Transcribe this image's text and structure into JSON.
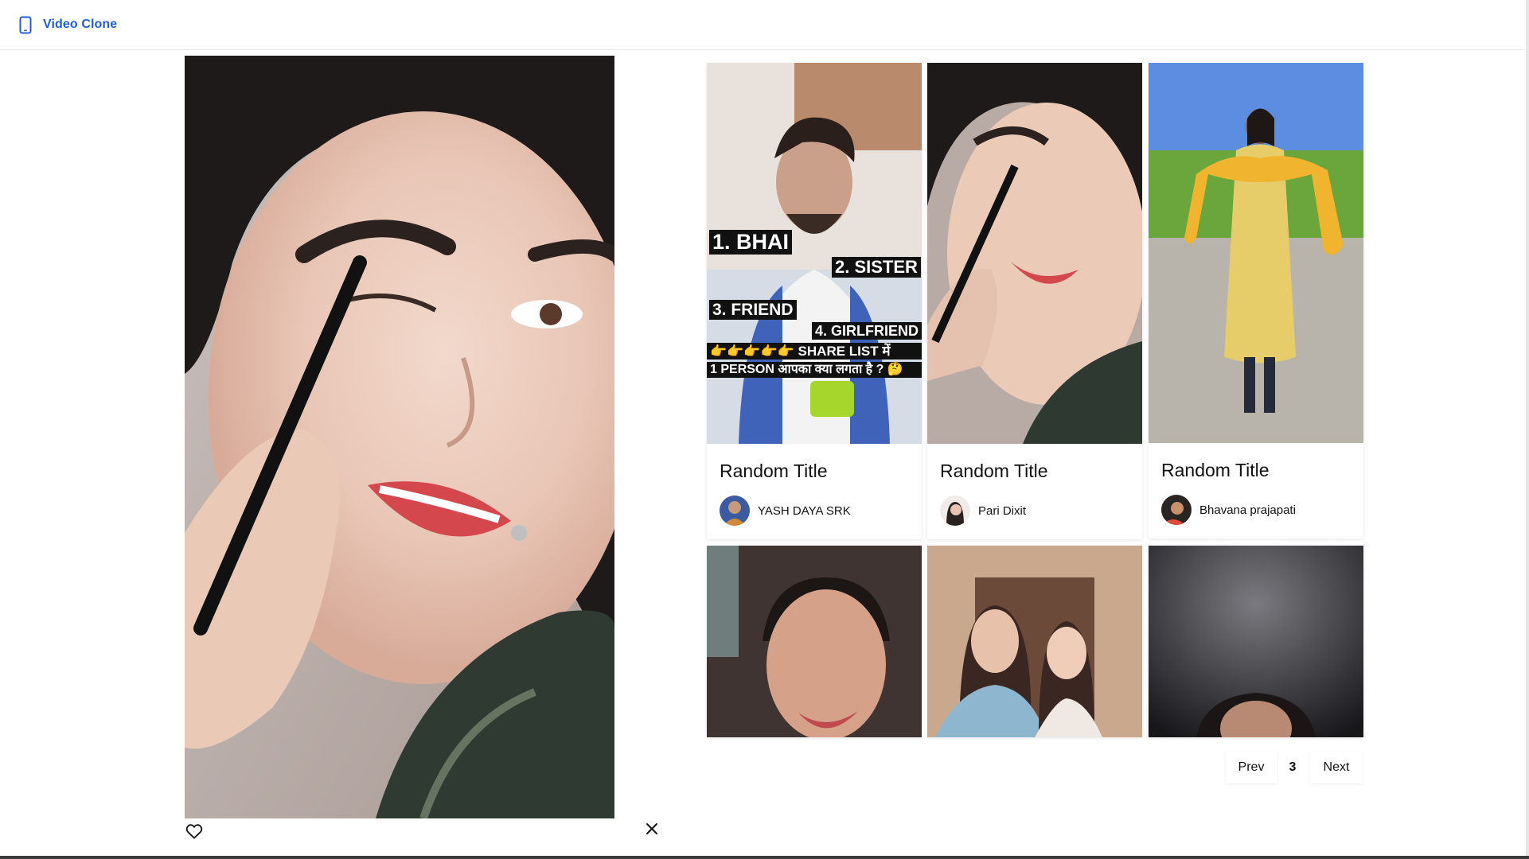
{
  "app": {
    "title": "Video Clone",
    "brand_color": "#1f5fd6"
  },
  "player": {
    "icons": {
      "like": "heart-outline-icon",
      "close": "close-x-icon"
    }
  },
  "cards": [
    {
      "title": "Random Title",
      "author": "YASH DAYA SRK",
      "overlay": [
        "1. BHAI",
        "2. SISTER",
        "3. FRIEND",
        "4. GIRLFRIEND",
        "👉👉👉👉👉 SHARE LIST में",
        "1 PERSON आपका क्या लगता है ? 🤔"
      ]
    },
    {
      "title": "Random Title",
      "author": "Pari Dixit"
    },
    {
      "title": "Random Title",
      "author": "Bhavana prajapati"
    },
    {
      "title": "",
      "author": ""
    },
    {
      "title": "",
      "author": ""
    },
    {
      "title": "",
      "author": ""
    }
  ],
  "pagination": {
    "prev_label": "Prev",
    "current_page": "3",
    "next_label": "Next"
  }
}
